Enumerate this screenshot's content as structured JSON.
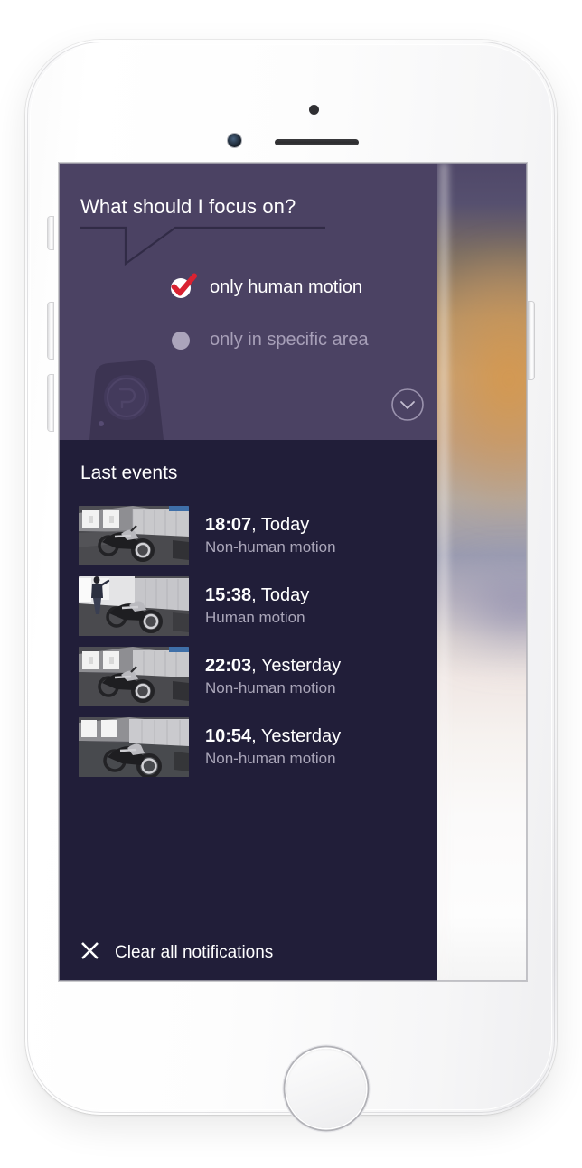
{
  "device": {
    "name": "white-smartphone",
    "front_camera": "front-camera-icon",
    "earpiece": "earpiece-speaker-icon",
    "proximity_sensor": "proximity-sensor-icon",
    "home_button": "home-button",
    "side_buttons": [
      "mute-switch",
      "volume-up-button",
      "volume-down-button",
      "power-button"
    ]
  },
  "colors": {
    "panel_purple": "#4b4263",
    "panel_dark": "#211e39",
    "accent_red": "#d92231",
    "text_primary": "#ffffff",
    "text_muted": "#aaa6b9",
    "radio_off": "#aba4bb"
  },
  "focus_card": {
    "title": "What should I focus on?",
    "bubble_tail_icon": "speech-bubble-tail",
    "camera_illustration_icon": "security-camera-illustration",
    "collapse_icon": "chevron-down-circle-icon",
    "options": [
      {
        "label": "only human motion",
        "state": "checked",
        "control_icon": "checkmark-icon"
      },
      {
        "label": "only  in specific area",
        "state": "unchecked",
        "control_icon": "radio-dot-icon"
      }
    ]
  },
  "events_card": {
    "title": "Last events",
    "items": [
      {
        "time": "18:07",
        "separator": ", ",
        "day": "Today",
        "type": "Non-human motion",
        "thumbnail_icon": "garage-motorcycle-thumbnail",
        "has_person": false
      },
      {
        "time": "15:38",
        "separator": ", ",
        "day": "Today",
        "type": "Human motion",
        "thumbnail_icon": "garage-person-motorcycle-thumbnail",
        "has_person": true
      },
      {
        "time": "22:03",
        "separator": ", ",
        "day": "Yesterday",
        "type": "Non-human motion",
        "thumbnail_icon": "garage-motorcycle-thumbnail",
        "has_person": false
      },
      {
        "time": "10:54",
        "separator": ", ",
        "day": "Yesterday",
        "type": "Non-human motion",
        "thumbnail_icon": "garage-motorcycle-thumbnail",
        "has_person": false
      }
    ]
  },
  "clear_bar": {
    "icon": "close-x-icon",
    "label": "Clear all notifications"
  }
}
